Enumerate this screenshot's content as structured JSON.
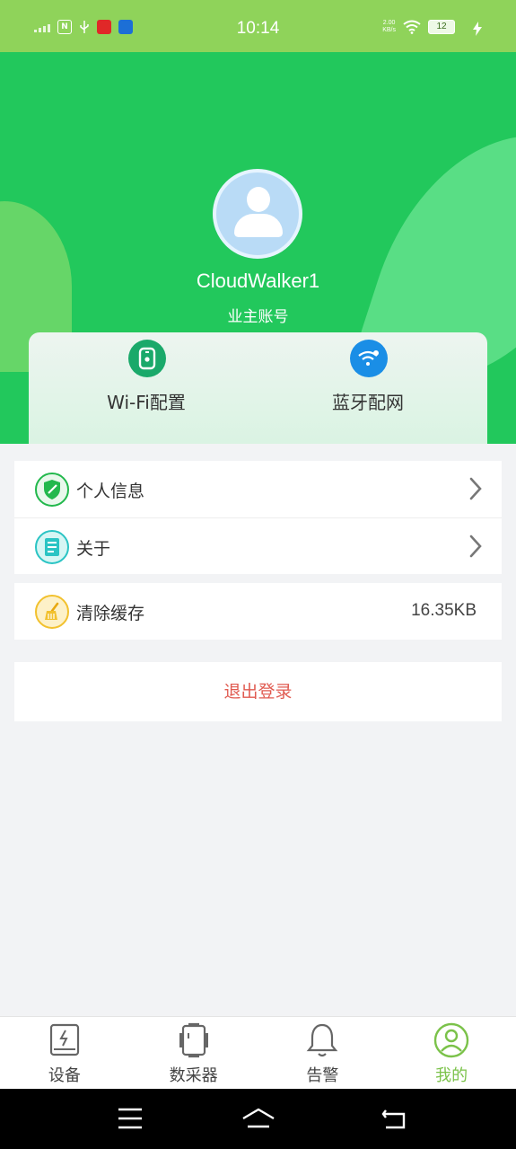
{
  "status_bar": {
    "time": "10:14",
    "speed_value": "2.00",
    "speed_unit": "KB/s",
    "battery": "12",
    "icons": [
      "signal-icon",
      "nfc-icon",
      "usb-icon",
      "app-notification-icon",
      "app-notification-icon",
      "wifi-icon",
      "charging-icon"
    ]
  },
  "profile": {
    "username": "CloudWalker1",
    "role": "业主账号"
  },
  "quick_actions": [
    {
      "label": "Wi-Fi配置",
      "icon": "wifi-device-icon",
      "color": "#1aa96a"
    },
    {
      "label": "蓝牙配网",
      "icon": "bluetooth-network-icon",
      "color": "#1a8ee6"
    }
  ],
  "menu": [
    {
      "label": "个人信息",
      "icon": "shield-icon",
      "color": "#22b84c"
    },
    {
      "label": "关于",
      "icon": "document-icon",
      "color": "#2bc4c4"
    }
  ],
  "cache": {
    "label": "清除缓存",
    "value": "16.35KB",
    "icon": "broom-icon",
    "color": "#f2c12e"
  },
  "logout_label": "退出登录",
  "tabs": [
    {
      "label": "设备",
      "icon": "device-icon",
      "active": false
    },
    {
      "label": "数采器",
      "icon": "collector-icon",
      "active": false
    },
    {
      "label": "告警",
      "icon": "bell-icon",
      "active": false
    },
    {
      "label": "我的",
      "icon": "user-circle-icon",
      "active": true
    }
  ],
  "colors": {
    "header_green": "#22c85c",
    "accent": "#7bc24a",
    "logout_red": "#e05a50"
  }
}
